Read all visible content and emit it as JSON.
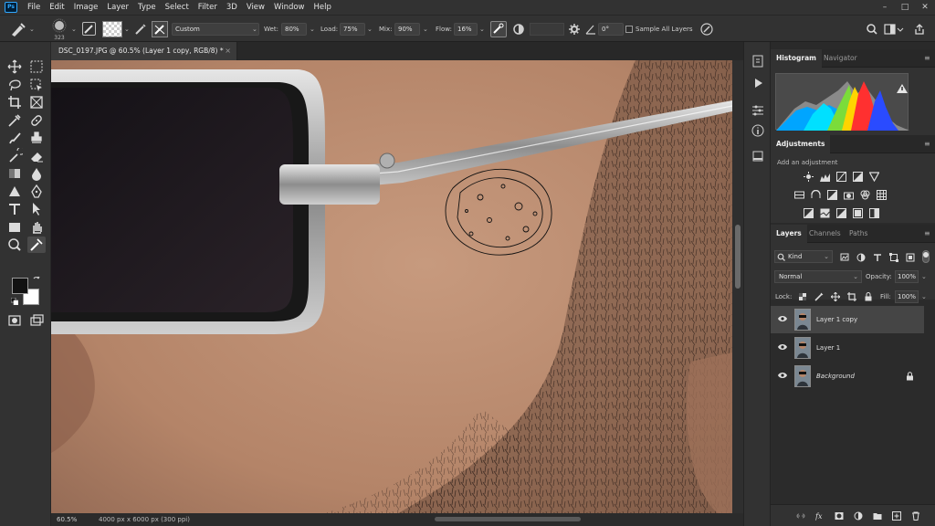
{
  "app": {
    "logo": "Ps",
    "name": "Adobe Photoshop"
  },
  "menubar": {
    "items": [
      "File",
      "Edit",
      "Image",
      "Layer",
      "Type",
      "Select",
      "Filter",
      "3D",
      "View",
      "Window",
      "Help"
    ]
  },
  "window_controls": {
    "minimize": "–",
    "maximize": "□",
    "close": "✕"
  },
  "options": {
    "brush_size": "323",
    "preset": "Custom",
    "wet_label": "Wet:",
    "wet_value": "80%",
    "load_label": "Load:",
    "load_value": "75%",
    "mix_label": "Mix:",
    "mix_value": "90%",
    "flow_label": "Flow:",
    "flow_value": "16%",
    "angle_value": "0°",
    "sample_all_layers_label": "Sample All Layers",
    "sample_all_layers_checked": false
  },
  "document": {
    "tab_title": "DSC_0197.JPG @ 60.5% (Layer 1 copy, RGB/8) *",
    "tab_close": "×",
    "zoom": "60.5%",
    "doc_info": "4000 px x 6000 px (300 ppi)"
  },
  "colors": {
    "foreground": "#121212",
    "background": "#ffffff",
    "accent_selected_layer": "#454545",
    "panel_bg": "#323232"
  },
  "panels": {
    "histogram": {
      "tabs": [
        "Histogram",
        "Navigator"
      ],
      "warning": "!"
    },
    "adjustments": {
      "tab": "Adjustments",
      "hint": "Add an adjustment"
    },
    "layers": {
      "tabs": [
        "Layers",
        "Channels",
        "Paths"
      ],
      "filter_kind": "Kind",
      "blend_mode": "Normal",
      "opacity_label": "Opacity:",
      "opacity_value": "100%",
      "lock_label": "Lock:",
      "fill_label": "Fill:",
      "fill_value": "100%",
      "items": [
        {
          "name": "Layer 1 copy",
          "visible": true,
          "selected": true,
          "locked": false
        },
        {
          "name": "Layer 1",
          "visible": true,
          "selected": false,
          "locked": false
        },
        {
          "name": "Background",
          "visible": true,
          "selected": false,
          "locked": true
        }
      ]
    }
  },
  "icons": {
    "toolbar": [
      "move-icon",
      "marquee-icon",
      "lasso-icon",
      "object-select-icon",
      "crop-icon",
      "frame-icon",
      "eyedropper-icon",
      "spot-heal-icon",
      "brush-icon",
      "stamp-icon",
      "history-brush-icon",
      "eraser-icon",
      "gradient-icon",
      "blur-icon",
      "dodge-icon",
      "pen-icon",
      "type-icon",
      "path-select-icon",
      "rectangle-icon",
      "hand-icon",
      "zoom-icon",
      "mixer-brush-icon",
      "quick-mask-icon",
      "screen-mode-icon"
    ]
  }
}
